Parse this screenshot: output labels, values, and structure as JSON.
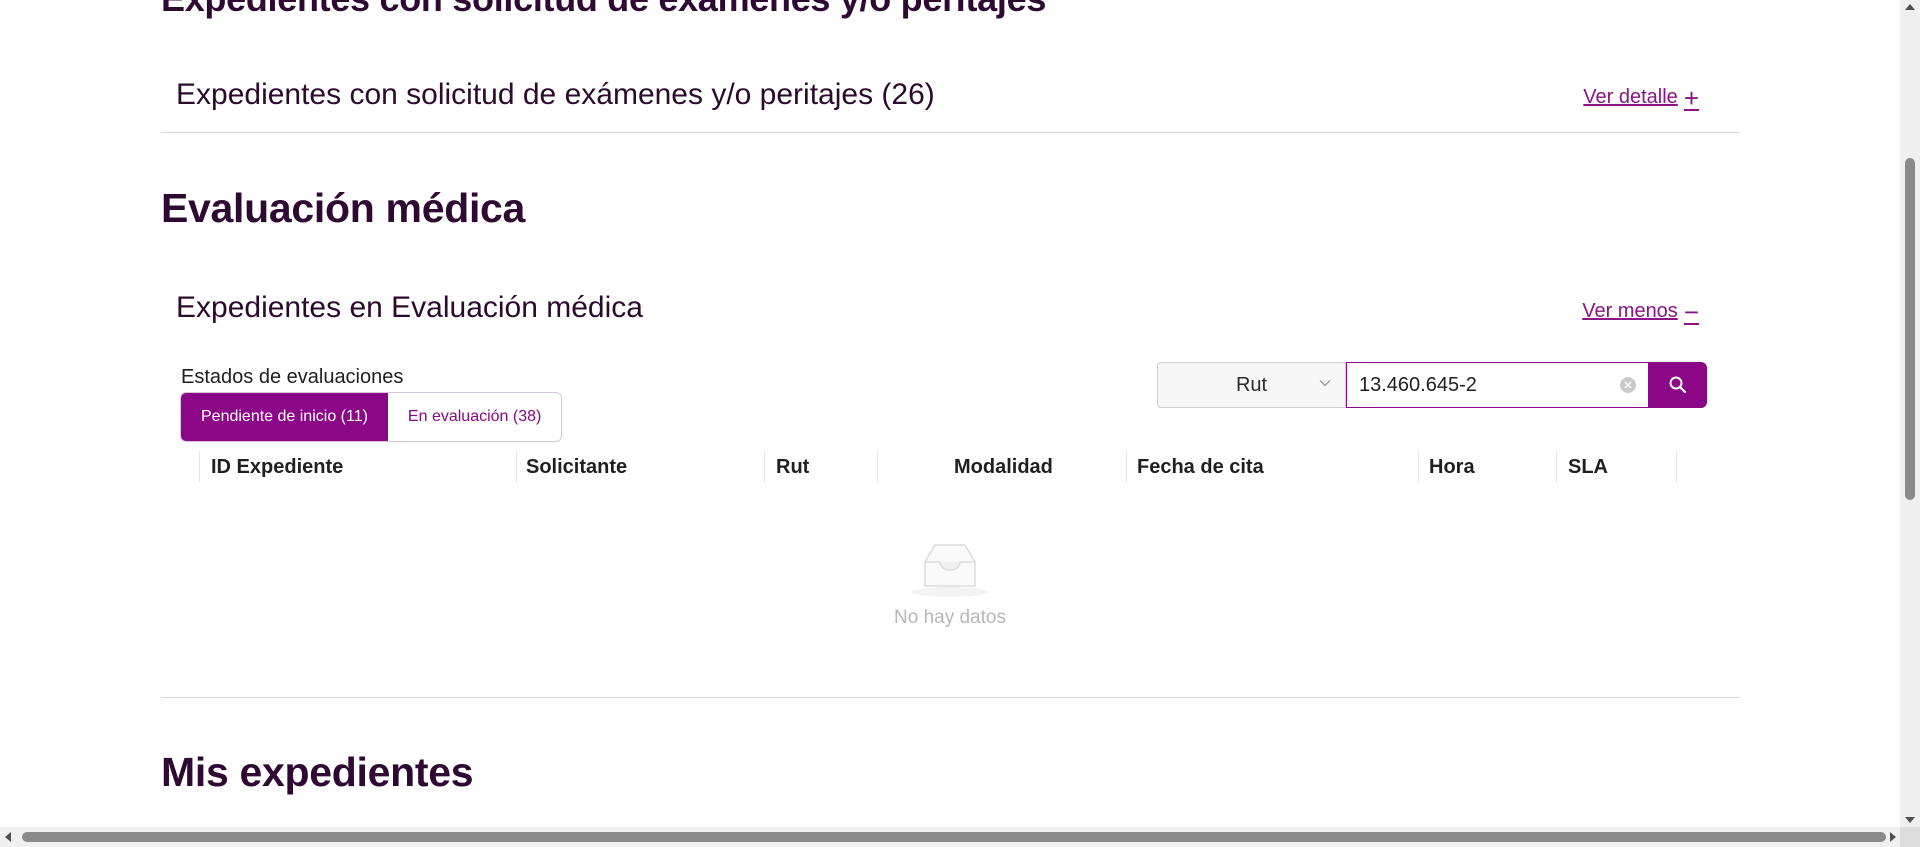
{
  "sections": {
    "top_heading": "Expedientes con solicitud de exámenes y/o peritajes",
    "evaluacion_heading": "Evaluación médica",
    "mis_heading": "Mis expedientes"
  },
  "panel_examenes": {
    "title": "Expedientes con solicitud de exámenes y/o peritajes (26)",
    "link_label": "Ver detalle",
    "link_icon": "plus-icon"
  },
  "panel_evaluacion": {
    "title": "Expedientes en Evaluación médica",
    "link_label": "Ver menos",
    "link_icon": "minus-icon",
    "estados_label": "Estados de evaluaciones",
    "tabs": [
      {
        "label": "Pendiente de inicio (11)",
        "active": true
      },
      {
        "label": "En evaluación (38)",
        "active": false
      }
    ],
    "filter": {
      "select_value": "Rut",
      "input_value": "13.460.645-2"
    },
    "columns": [
      "ID Expediente",
      "Solicitante",
      "Rut",
      "Modalidad",
      "Fecha de cita",
      "Hora",
      "SLA"
    ],
    "empty_text": "No hay datos"
  },
  "colors": {
    "accent": "#8b0788",
    "heading": "#2e0a33"
  }
}
